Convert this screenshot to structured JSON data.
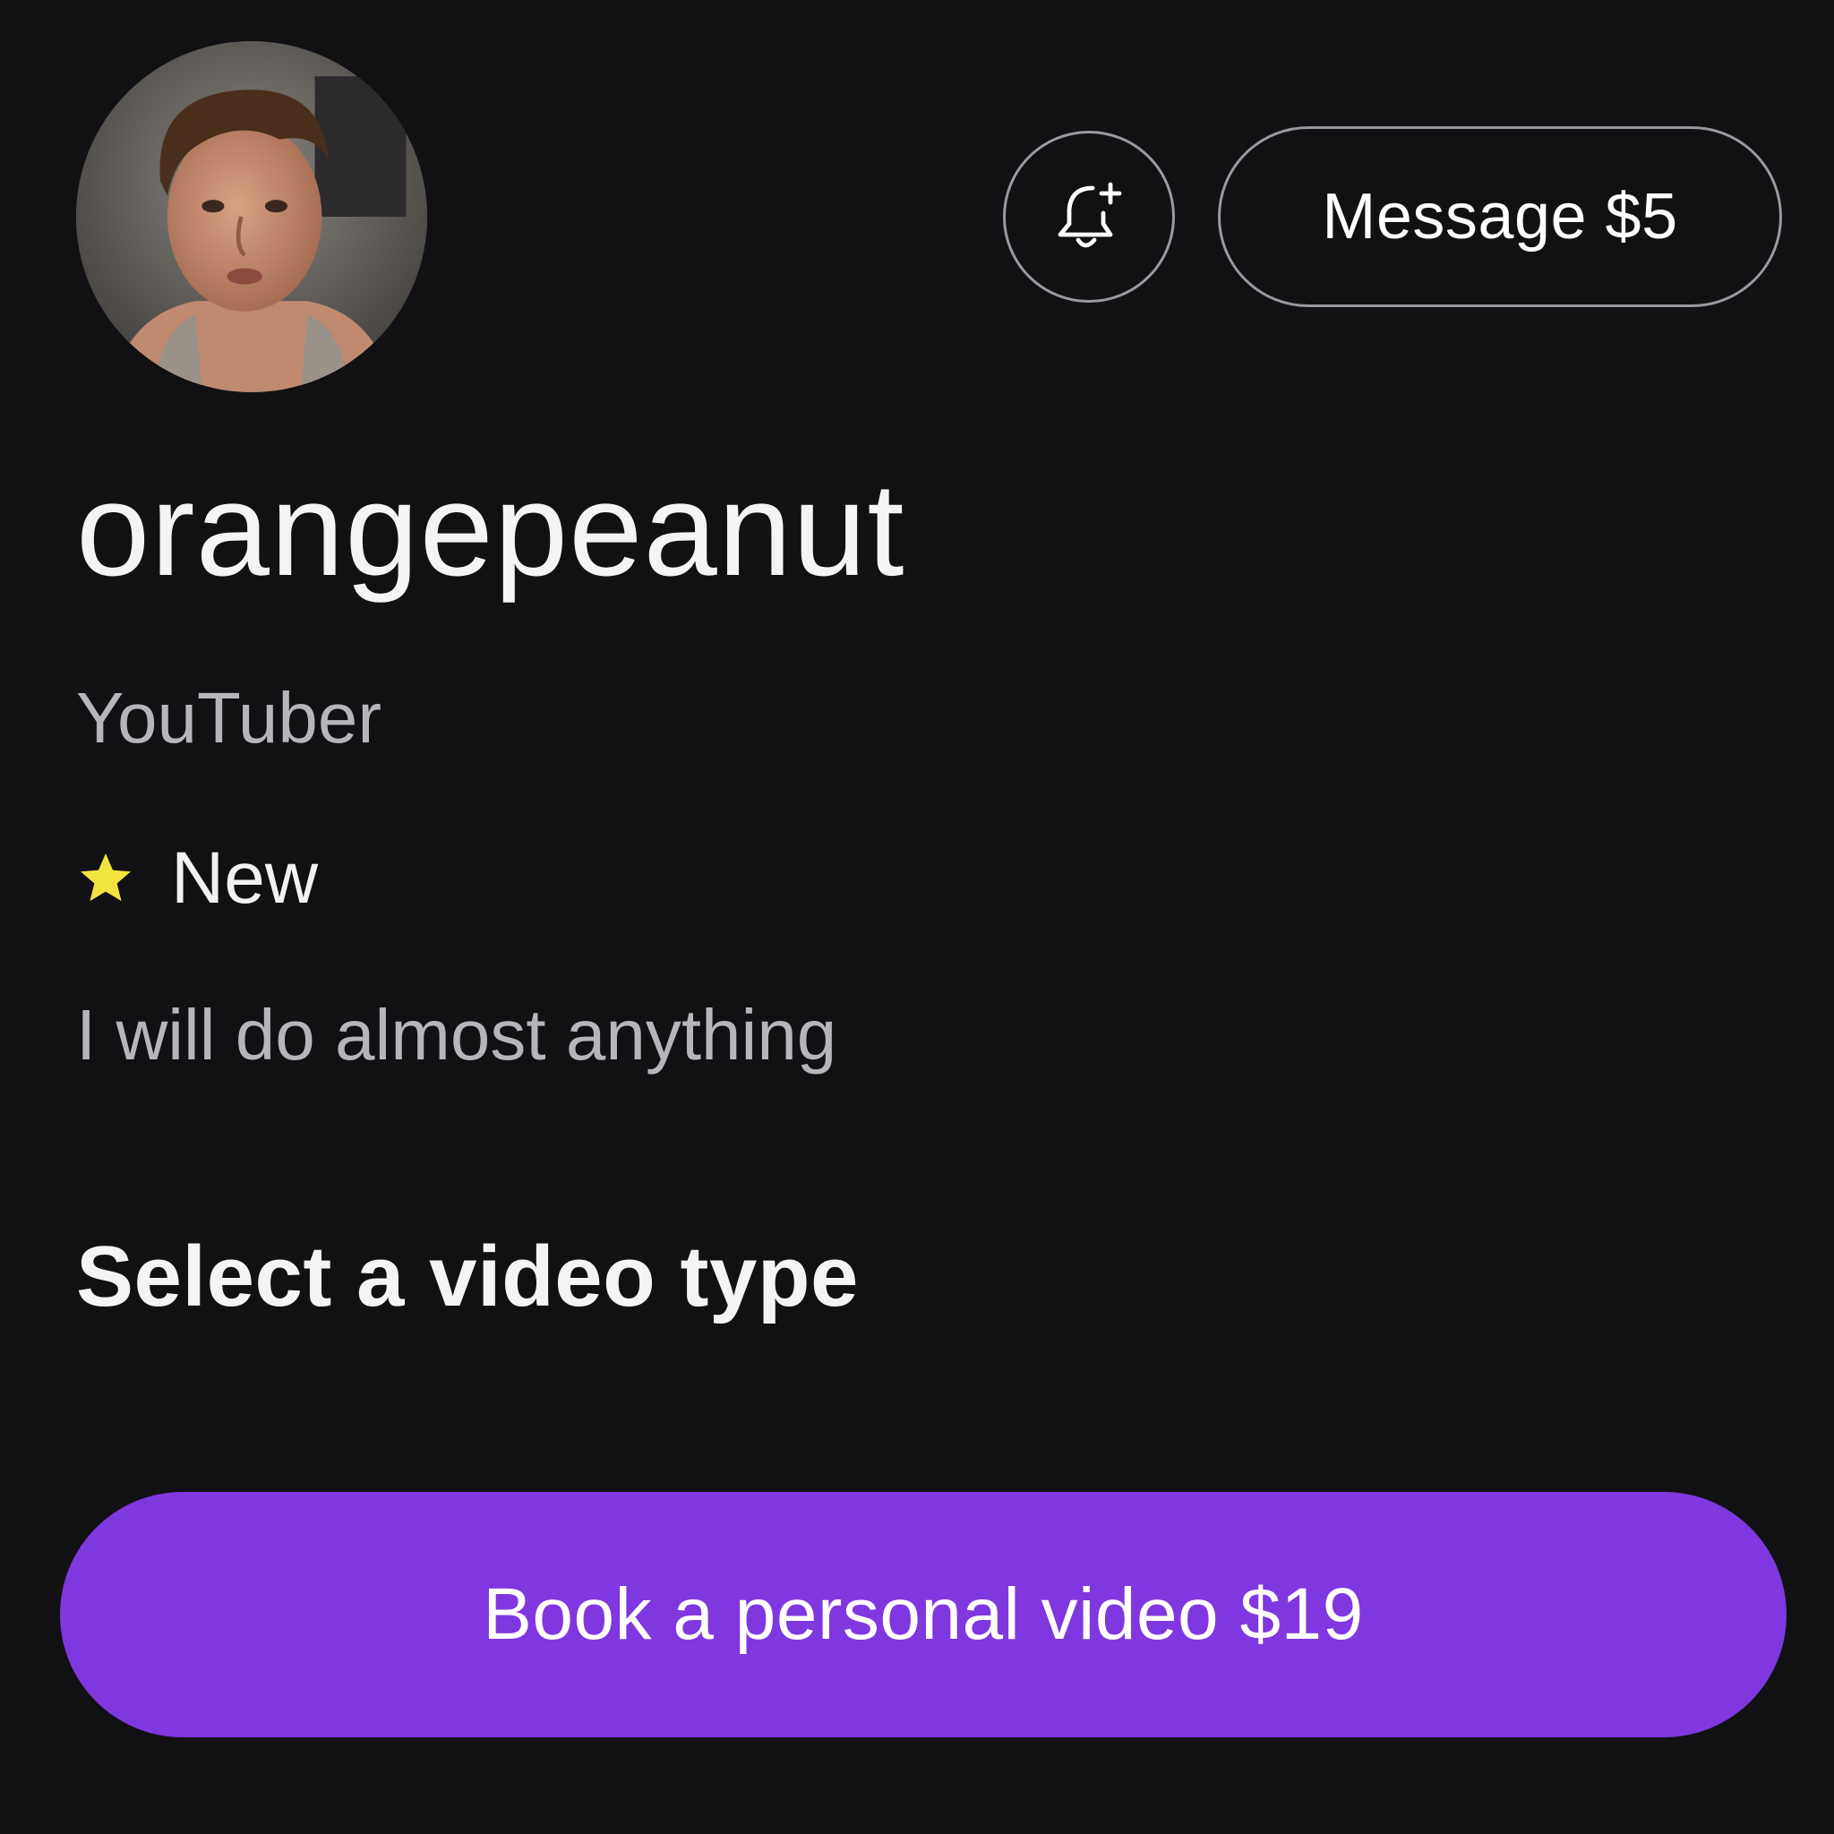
{
  "profile": {
    "username": "orangepeanut",
    "category": "YouTuber",
    "rating_label": "New",
    "bio": "I will do almost anything"
  },
  "actions": {
    "message_label": "Message $5",
    "book_label": "Book a personal video $19"
  },
  "section": {
    "heading": "Select a video type"
  },
  "icons": {
    "notify": "bell-plus-icon",
    "rating": "star-icon"
  },
  "colors": {
    "background": "#111114",
    "accent": "#7f37e0",
    "star": "#f3e33f",
    "muted_text": "#b6b6ba"
  }
}
